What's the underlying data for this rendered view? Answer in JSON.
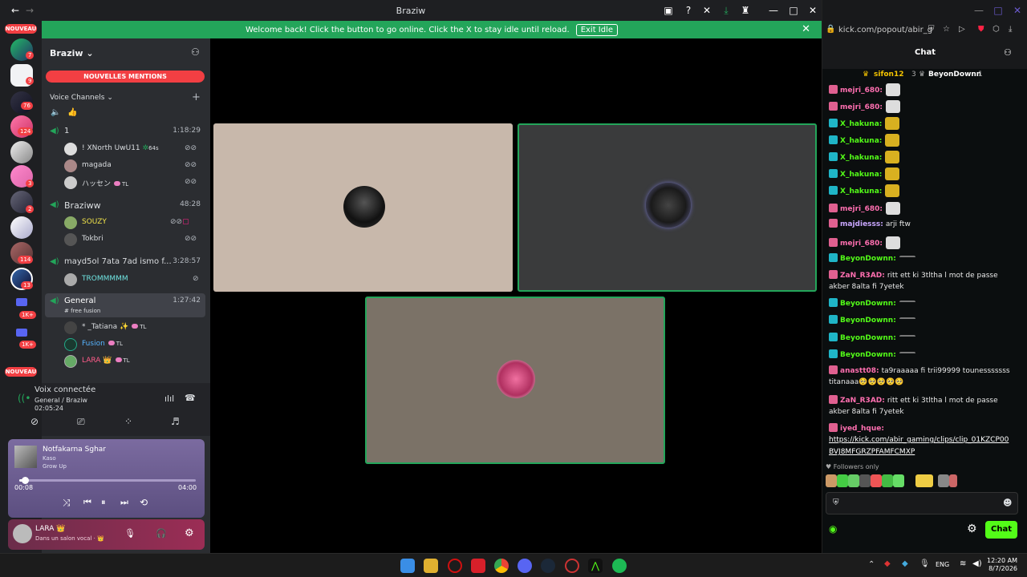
{
  "window": {
    "title": "Braziw"
  },
  "banner": {
    "text": "Welcome back! Click the button to go online. Click the X to stay idle until reload.",
    "button": "Exit Idle"
  },
  "guilds": {
    "nouveau_top": "NOUVEAU",
    "nouveau_bottom": "NOUVEAU",
    "badges": [
      "7",
      "9",
      "76",
      "124",
      "3",
      "2",
      "114",
      "13",
      "1K+",
      "1K+"
    ]
  },
  "sidebar": {
    "server_name": "Braziw",
    "mentions": "NOUVELLES MENTIONS",
    "category": "Voice Channels",
    "channels": [
      {
        "name": "1",
        "time": "1:18:29",
        "users": [
          {
            "name": "! XNorth UwU11",
            "tag": "64s"
          },
          {
            "name": "magada"
          },
          {
            "name": "ハッセン",
            "tl": "TL"
          }
        ]
      },
      {
        "name": "Braziww",
        "time": "48:28",
        "users": [
          {
            "name": "SOUZY"
          },
          {
            "name": "Tokbri"
          }
        ]
      },
      {
        "name": "mayd5ol 7ata 7ad ismo f...",
        "time": "3:28:57",
        "users": [
          {
            "name": "TROMMMMM"
          }
        ]
      },
      {
        "name": "General",
        "time": "1:27:42",
        "subtitle": "# free fusion",
        "users": [
          {
            "name": "* _Tatiana ✨",
            "tl": "TL"
          },
          {
            "name": "Fusion",
            "tl": "TL"
          },
          {
            "name": "LARA 👑",
            "tl": "TL"
          }
        ]
      }
    ]
  },
  "voice": {
    "status": "Voix connectée",
    "channel": "General / Braziw",
    "duration": "02:05:24"
  },
  "player": {
    "title": "Notfakarna Sghar",
    "artist": "Kaso",
    "album": "Grow Up",
    "elapsed": "00:08",
    "total": "04:00",
    "progress": 0.03
  },
  "user": {
    "name": "LARA 👑",
    "status": "Dans un salon vocal · 👑"
  },
  "kick": {
    "url": "kick.com/popout/abir_g",
    "header": "Chat",
    "top_gifters": [
      {
        "name": "sifon12",
        "count": "3"
      },
      {
        "name": "BeyonDownn",
        "count": "1"
      }
    ],
    "messages": [
      {
        "user": "mejri_680:",
        "color": "#ff6fb0",
        "text": ""
      },
      {
        "user": "mejri_680:",
        "color": "#ff6fb0",
        "text": ""
      },
      {
        "user": "X_hakuna:",
        "color": "#53fc18",
        "text": ""
      },
      {
        "user": "X_hakuna:",
        "color": "#53fc18",
        "text": ""
      },
      {
        "user": "X_hakuna:",
        "color": "#53fc18",
        "text": ""
      },
      {
        "user": "X_hakuna:",
        "color": "#53fc18",
        "text": ""
      },
      {
        "user": "X_hakuna:",
        "color": "#53fc18",
        "text": ""
      },
      {
        "user": "mejri_680:",
        "color": "#ff6fb0",
        "text": ""
      },
      {
        "user": "majdiesss:",
        "color": "#c9a7ff",
        "text": "arji ftw"
      },
      {
        "user": "mejri_680:",
        "color": "#ff6fb0",
        "text": ""
      },
      {
        "user": "BeyonDownn:",
        "color": "#53fc18",
        "text": ""
      },
      {
        "user": "ZaN_R3AD:",
        "color": "#ff6fb0",
        "text": "ritt ett ki 3tltha l mot de passe",
        "text2": "akber 8alta fi 7yetek"
      },
      {
        "user": "BeyonDownn:",
        "color": "#53fc18",
        "text": ""
      },
      {
        "user": "BeyonDownn:",
        "color": "#53fc18",
        "text": ""
      },
      {
        "user": "BeyonDownn:",
        "color": "#53fc18",
        "text": ""
      },
      {
        "user": "BeyonDownn:",
        "color": "#53fc18",
        "text": ""
      },
      {
        "user": "anastt08:",
        "color": "#ff6fb0",
        "text": "ta9raaaaa fi trii99999 tounesssssss",
        "text2": "titanaaa🥺🥺🥺🥺🥺"
      },
      {
        "user": "ZaN_R3AD:",
        "color": "#ff6fb0",
        "text": "ritt ett ki 3tltha l mot de passe",
        "text2": "akber 8alta fi 7yetek"
      },
      {
        "user": "iyed_hque:",
        "color": "#ff6fb0",
        "text": "",
        "link": "https://kick.com/abir_gaming/clips/clip_01KZCP00",
        "link2": "BVJ8MFGRZPFAMFCMXP"
      }
    ],
    "followers_only": "Followers only",
    "chat_button": "Chat"
  },
  "taskbar": {
    "lang": "ENG",
    "time": "12:20 AM",
    "date": "8/7/2026"
  },
  "colors": {
    "discord_green": "#23a55a",
    "kick_green": "#53fc18",
    "mention_red": "#f23f43"
  }
}
